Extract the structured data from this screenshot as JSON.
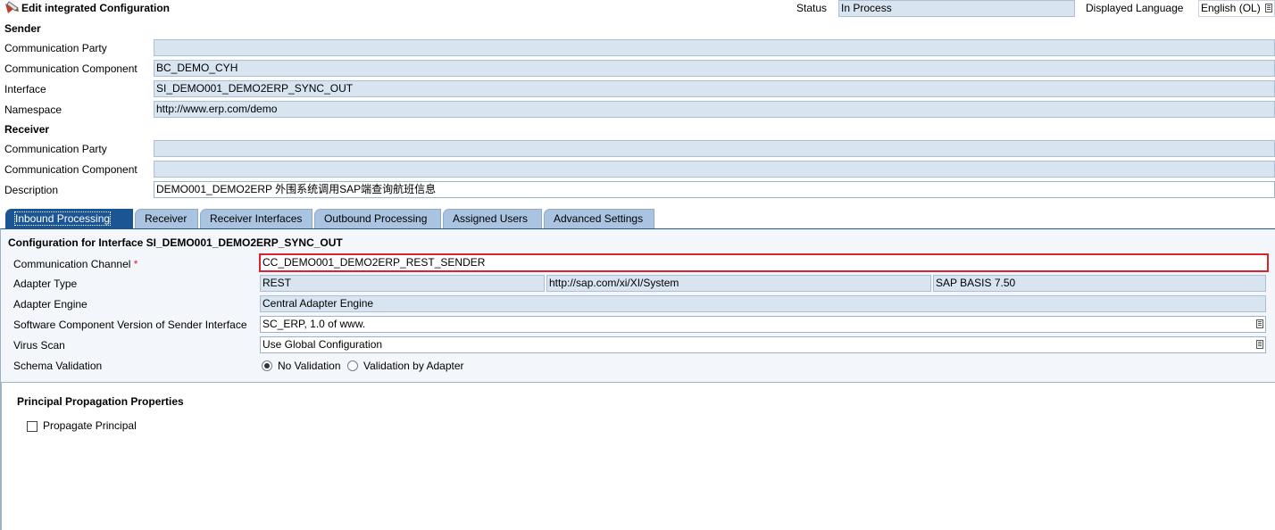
{
  "header": {
    "title": "Edit integrated Configuration",
    "status_label": "Status",
    "status_value": "In Process",
    "language_label": "Displayed Language",
    "language_value": "English (OL)"
  },
  "sender": {
    "heading": "Sender",
    "comm_party_label": "Communication Party",
    "comm_party_value": "",
    "comm_component_label": "Communication Component",
    "comm_component_value": "BC_DEMO_CYH",
    "interface_label": "Interface",
    "interface_value": "SI_DEMO001_DEMO2ERP_SYNC_OUT",
    "namespace_label": "Namespace",
    "namespace_value": "http://www.erp.com/demo"
  },
  "receiver": {
    "heading": "Receiver",
    "comm_party_label": "Communication Party",
    "comm_party_value": "",
    "comm_component_label": "Communication Component",
    "comm_component_value": "",
    "description_label": "Description",
    "description_value": "DEMO001_DEMO2ERP 外围系统调用SAP端查询航班信息"
  },
  "tabs": [
    {
      "label": "Inbound Processing",
      "active": true
    },
    {
      "label": "Receiver"
    },
    {
      "label": "Receiver Interfaces"
    },
    {
      "label": "Outbound Processing"
    },
    {
      "label": "Assigned Users"
    },
    {
      "label": "Advanced Settings"
    }
  ],
  "inbound": {
    "section_title": "Configuration for Interface SI_DEMO001_DEMO2ERP_SYNC_OUT",
    "channel_label": "Communication Channel",
    "channel_required": "*",
    "channel_value": "CC_DEMO001_DEMO2ERP_REST_SENDER",
    "adapter_type_label": "Adapter Type",
    "adapter_type_value": "REST",
    "adapter_namespace_value": "http://sap.com/xi/XI/System",
    "adapter_swc_value": "SAP BASIS 7.50",
    "adapter_engine_label": "Adapter Engine",
    "adapter_engine_value": "Central Adapter Engine",
    "swcv_label": "Software Component Version of Sender Interface",
    "swcv_value": "SC_ERP, 1.0 of www.",
    "virus_scan_label": "Virus Scan",
    "virus_scan_value": "Use Global Configuration",
    "schema_validation_label": "Schema Validation",
    "schema_option_none": "No Validation",
    "schema_option_adapter": "Validation by Adapter",
    "schema_selected": "No Validation"
  },
  "principal": {
    "heading": "Principal Propagation Properties",
    "propagate_label": "Propagate Principal",
    "propagate_checked": false
  }
}
